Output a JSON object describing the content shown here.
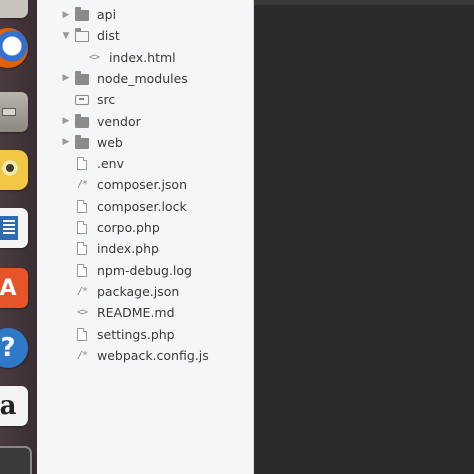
{
  "launcher": {
    "items": [
      {
        "name": "launcher-top-app-icon",
        "glyph": ""
      },
      {
        "name": "firefox-icon",
        "glyph": ""
      },
      {
        "name": "files-icon",
        "glyph": ""
      },
      {
        "name": "rhythmbox-icon",
        "glyph": ""
      },
      {
        "name": "libreoffice-writer-icon",
        "glyph": ""
      },
      {
        "name": "software-center-icon",
        "glyph": "A"
      },
      {
        "name": "help-icon",
        "glyph": "?"
      },
      {
        "name": "amazon-icon",
        "glyph": "a"
      },
      {
        "name": "launcher-bottom-app-icon",
        "glyph": ""
      }
    ]
  },
  "tree": {
    "items": [
      {
        "label": "api",
        "type": "folder",
        "expanded": false,
        "depth": 0
      },
      {
        "label": "dist",
        "type": "folder",
        "expanded": true,
        "depth": 0
      },
      {
        "label": "index.html",
        "type": "code",
        "depth": 1
      },
      {
        "label": "node_modules",
        "type": "folder",
        "expanded": false,
        "depth": 0
      },
      {
        "label": "src",
        "type": "src",
        "depth": 0
      },
      {
        "label": "vendor",
        "type": "folder",
        "expanded": false,
        "depth": 0
      },
      {
        "label": "web",
        "type": "folder",
        "expanded": false,
        "depth": 0
      },
      {
        "label": ".env",
        "type": "file",
        "depth": 0
      },
      {
        "label": "composer.json",
        "type": "json",
        "depth": 0
      },
      {
        "label": "composer.lock",
        "type": "file",
        "depth": 0
      },
      {
        "label": "corpo.php",
        "type": "file",
        "depth": 0
      },
      {
        "label": "index.php",
        "type": "file",
        "depth": 0
      },
      {
        "label": "npm-debug.log",
        "type": "file",
        "depth": 0
      },
      {
        "label": "package.json",
        "type": "json",
        "depth": 0
      },
      {
        "label": "README.md",
        "type": "code",
        "depth": 0
      },
      {
        "label": "settings.php",
        "type": "file",
        "depth": 0
      },
      {
        "label": "webpack.config.js",
        "type": "json",
        "depth": 0
      }
    ]
  },
  "icons": {
    "chevron_right": "▶",
    "chevron_down": "▼",
    "code_glyph": "<>",
    "json_glyph": "/*"
  },
  "colors": {
    "sidebar_bg": "#f5f6f7",
    "editor_bg": "#2b2b29",
    "launcher_bg": "#3f3236"
  }
}
